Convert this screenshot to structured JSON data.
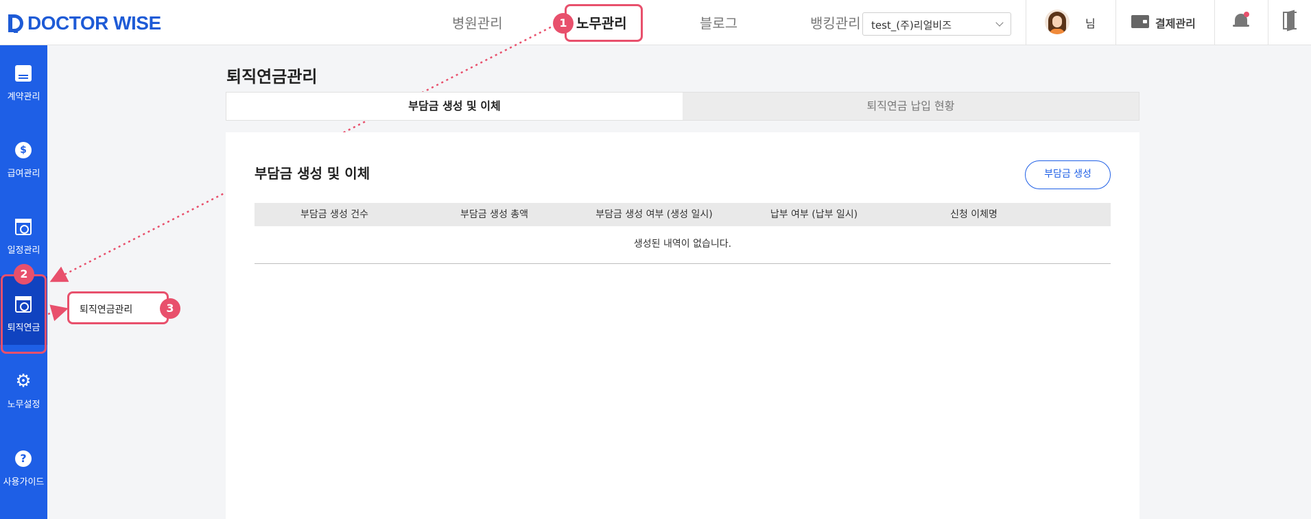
{
  "brand": {
    "logo_text": "DOCTOR WISE",
    "accent_color": "#1e5fe6",
    "highlight_color": "#e8506c"
  },
  "header": {
    "nav": [
      "병원관리",
      "노무관리",
      "블로그",
      "뱅킹관리"
    ],
    "active_nav": "노무관리",
    "company_select": {
      "value": "test_(주)리얼비즈",
      "icon": "chevron-down-icon"
    },
    "user": {
      "name": "님",
      "icon": "avatar"
    },
    "payment_label": "결제관리",
    "notification_icon": "bell-icon",
    "logout_icon": "logout-icon"
  },
  "sidebar": {
    "items": [
      {
        "label": "계약관리",
        "icon": "document-icon"
      },
      {
        "label": "급여관리",
        "icon": "dollar-icon"
      },
      {
        "label": "일정관리",
        "icon": "calendar-icon"
      },
      {
        "label": "퇴직연금",
        "icon": "calendar-clock-icon"
      },
      {
        "label": "노무설정",
        "icon": "gear-icon"
      },
      {
        "label": "사용가이드",
        "icon": "help-icon"
      }
    ],
    "active_item": "퇴직연금"
  },
  "flyout": {
    "item": "퇴직연금관리"
  },
  "annotations": {
    "badges": [
      "1",
      "2",
      "3"
    ]
  },
  "main": {
    "page_title": "퇴직연금관리",
    "tabs": [
      {
        "label": "부담금 생성 및 이체",
        "active": true
      },
      {
        "label": "퇴직연금 납입 현황",
        "active": false
      }
    ],
    "section_title": "부담금 생성 및 이체",
    "create_button": "부담금 생성",
    "table": {
      "columns": [
        "부담금 생성 건수",
        "부담금 생성 총액",
        "부담금 생성 여부 (생성 일시)",
        "납부 여부 (납부 일시)",
        "신청 이체명"
      ],
      "empty_message": "생성된 내역이 없습니다."
    }
  }
}
